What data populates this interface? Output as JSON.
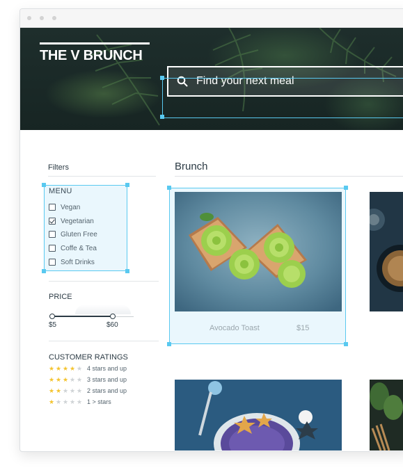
{
  "header": {
    "brand": "THE V BRUNCH",
    "search_placeholder": "Find your next meal"
  },
  "filters": {
    "title": "Filters",
    "menu": {
      "title": "MENU",
      "items": [
        {
          "label": "Vegan",
          "checked": false
        },
        {
          "label": "Vegetarian",
          "checked": true
        },
        {
          "label": "Gluten Free",
          "checked": false
        },
        {
          "label": "Coffe & Tea",
          "checked": false
        },
        {
          "label": "Soft Drinks",
          "checked": false
        }
      ]
    },
    "price": {
      "title": "PRICE",
      "min_label": "$5",
      "max_label": "$60"
    },
    "ratings": {
      "title": "CUSTOMER RATINGS",
      "items": [
        {
          "stars": 4,
          "label": "4 stars and up"
        },
        {
          "stars": 3,
          "label": "3 stars and up"
        },
        {
          "stars": 2,
          "label": "2 stars and up"
        },
        {
          "stars": 1,
          "label": "1 > stars"
        }
      ]
    }
  },
  "main": {
    "section_title": "Brunch",
    "cards": [
      {
        "name": "Avocado Toast",
        "price": "$15",
        "image": "avocado-toast-photo"
      },
      {
        "name": "",
        "price": "",
        "image": "dark-bowl-photo"
      },
      {
        "name": "",
        "price": "",
        "image": "smoothie-bowl-photo"
      },
      {
        "name": "",
        "price": "",
        "image": "greens-photo"
      }
    ]
  },
  "colors": {
    "selection": "#59c9f0",
    "selection_fill": "#eaf7fd",
    "text_dark": "#2b3a44",
    "star_on": "#f4c430",
    "star_off": "#cfd3d6",
    "hero_dark": "#1a2928"
  },
  "icons": [
    "search-icon",
    "star-icon",
    "checkbox-icon"
  ]
}
